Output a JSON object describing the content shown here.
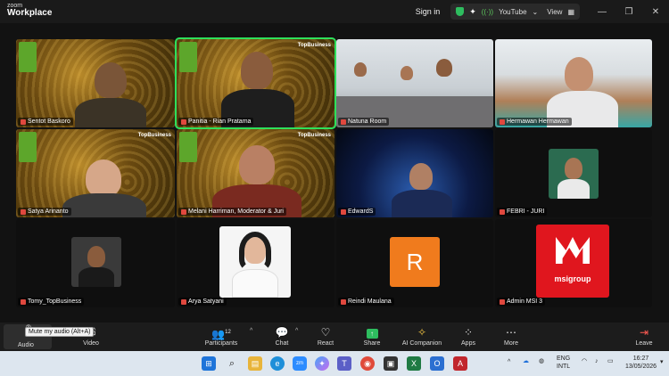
{
  "titlebar": {
    "logo_line1": "zoom",
    "logo_line2": "Workplace",
    "signin": "Sign in",
    "stream_label": "YouTube",
    "view_label": "View",
    "minimize": "—",
    "restore": "❐",
    "close": "✕"
  },
  "tiles": [
    {
      "name": "Sentot Baskoro"
    },
    {
      "name": "Panitia - Rian Pratama"
    },
    {
      "name": "Natuna Room"
    },
    {
      "name": "Hermawan Hermawan"
    },
    {
      "name": "Satya Arinanto"
    },
    {
      "name": "Melani Harriman, Moderator & Juri"
    },
    {
      "name": "EdwardS"
    },
    {
      "name": "FEBRI - JURI"
    },
    {
      "name": "Tomy_TopBusiness"
    },
    {
      "name": "Arya Satyani"
    },
    {
      "name": "Reindi Maulana",
      "avatar_letter": "R",
      "avatar_color": "#f07b1d"
    },
    {
      "name": "Admin MSI 3",
      "logo_text": "msigroup",
      "logo_color": "#e0161e"
    }
  ],
  "brand_text": "TopBusiness",
  "toolbar": {
    "audio": "Audio",
    "video": "Video",
    "participants": "Participants",
    "participants_count": "12",
    "chat": "Chat",
    "react": "React",
    "share": "Share",
    "ai_companion": "AI Companion",
    "apps": "Apps",
    "more": "More",
    "leave": "Leave",
    "tooltip": "Mute my audio (Alt+A)"
  },
  "taskbar": {
    "lang_line1": "ENG",
    "lang_line2": "INTL",
    "time": "16:27",
    "date": "13/05/2026"
  },
  "colors": {
    "active_speaker": "#2ee05b",
    "share_green": "#2ebd5f",
    "leave_red": "#ff5a52"
  }
}
